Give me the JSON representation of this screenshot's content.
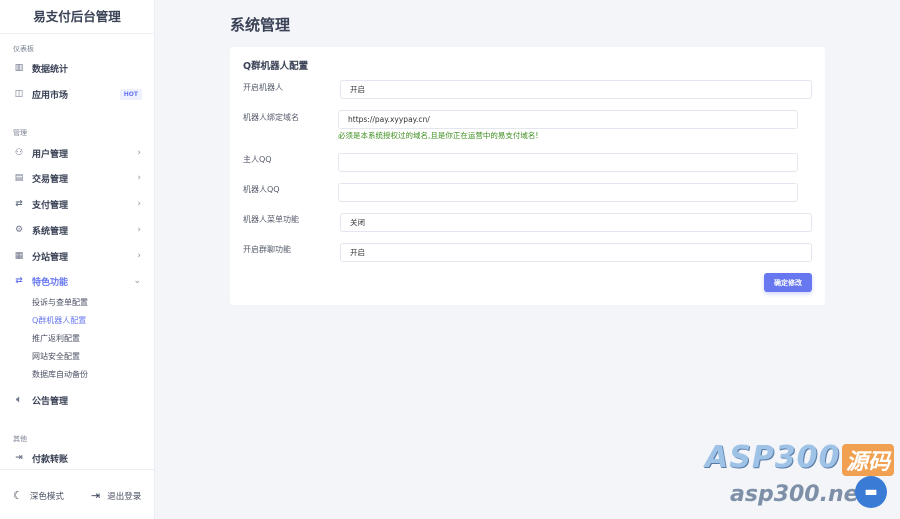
{
  "sidebar": {
    "brand": "易支付后台管理",
    "sections": [
      "仪表板",
      "管理",
      "其他"
    ],
    "items": [
      {
        "label": "数据统计"
      },
      {
        "label": "应用市场",
        "badge": "HOT"
      },
      {
        "label": "用户管理"
      },
      {
        "label": "交易管理"
      },
      {
        "label": "支付管理"
      },
      {
        "label": "系统管理"
      },
      {
        "label": "分站管理"
      },
      {
        "label": "特色功能"
      },
      {
        "label": "公告管理"
      },
      {
        "label": "付款转账"
      }
    ],
    "subitems": [
      "投诉与查单配置",
      "Q群机器人配置",
      "推广返利配置",
      "网站安全配置",
      "数据库自动备份"
    ],
    "footer": {
      "dark_mode": "深色模式",
      "logout": "退出登录"
    }
  },
  "page": {
    "title": "系统管理"
  },
  "card": {
    "title": "Q群机器人配置",
    "fields": [
      {
        "label": "开启机器人",
        "value": "开启"
      },
      {
        "label": "机器人绑定域名",
        "value": "https://pay.xyypay.cn/"
      },
      {
        "label": "主人QQ",
        "value": ""
      },
      {
        "label": "机器人QQ",
        "value": ""
      },
      {
        "label": "机器人菜单功能",
        "value": "关闭"
      },
      {
        "label": "开启群聊功能",
        "value": "开启"
      }
    ],
    "hint": "必须是本系统授权过的域名,且是你正在运营中的易支付域名!",
    "submit": "确定修改"
  },
  "watermark": {
    "brand": "ASP300",
    "tag": "源码",
    "url": "asp300.net"
  },
  "colors": {
    "accent": "#6777ef",
    "hint": "#3c8f1e"
  }
}
